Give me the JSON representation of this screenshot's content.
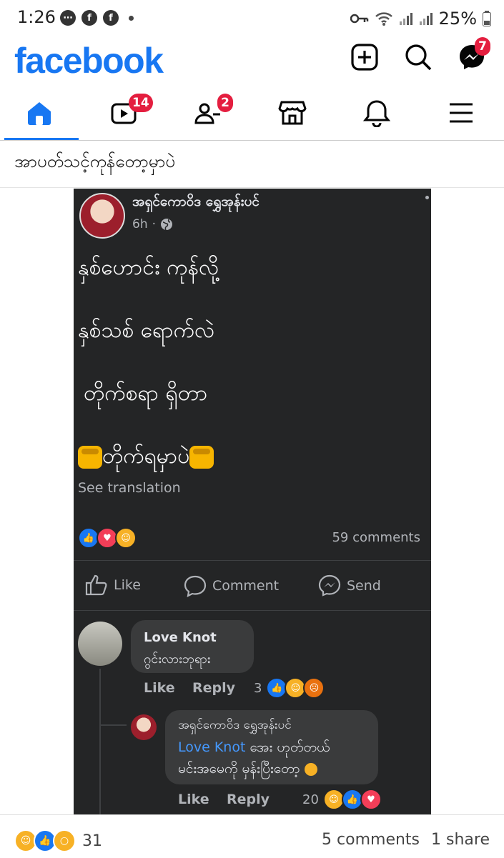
{
  "status_bar": {
    "time": "1:26",
    "battery": "25%"
  },
  "header": {
    "logo": "facebook",
    "messenger_badge": "7"
  },
  "tabs": {
    "video_badge": "14",
    "friends_badge": "2"
  },
  "caption": "အာပတ်သင့်ကုန်တော့မှာပဲ",
  "post": {
    "author": "အရှင်ကောဝိဒ ရွှေအုန်းပင်",
    "time": "6h",
    "lines": [
      "နှစ်ဟောင်း ကုန်လို့",
      "နှစ်သစ် ရောက်လဲ",
      "တိုက်စရာ ရှိတာ",
      "တိုက်ရမှာပဲ"
    ],
    "see_translation": "See translation",
    "comments_count": "59 comments",
    "actions": {
      "like": "Like",
      "comment": "Comment",
      "send": "Send"
    }
  },
  "comments": [
    {
      "author": "Love Knot",
      "text": "ဂွင်းလားဘုရား",
      "like": "Like",
      "reply": "Reply",
      "reactions": "3"
    },
    {
      "author": "အရှင်ကောဝိဒ ရွှေအုန်းပင်",
      "mention": "Love Knot",
      "text_1": "အေး ဟုတ်တယ်",
      "text_2": "မင်းအမေကို မှန်းပြီးတော့",
      "like": "Like",
      "reply": "Reply",
      "reactions": "20"
    }
  ],
  "footer": {
    "reactions_count": "31",
    "comments": "5 comments",
    "shares": "1 share"
  },
  "colors": {
    "brand": "#1877f2",
    "badge": "#e41e3f",
    "dark_bg": "#242526"
  }
}
